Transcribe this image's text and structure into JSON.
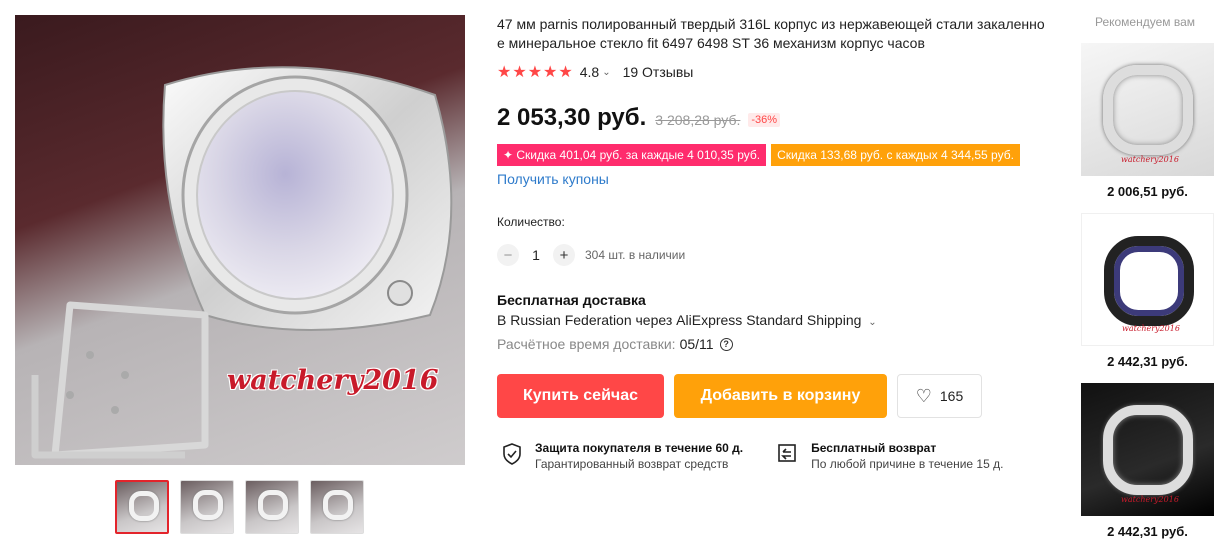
{
  "gallery": {
    "watermark": "watchery2016",
    "thumb_count": 4,
    "active_index": 0
  },
  "product": {
    "title": "47 мм parnis полированный твердый 316L корпус из нержавеющей стали закаленное минеральное стекло fit 6497 6498 ST 36 механизм корпус часов",
    "rating_value": "4.8",
    "reviews": "19 Отзывы",
    "price": "2 053,30 руб.",
    "old_price": "3 208,28 руб.",
    "discount": "-36%",
    "coupons": [
      {
        "text": "✦ Скидка 401,04 руб. за каждые 4 010,35 руб.",
        "color": "#ff2c6d"
      },
      {
        "text": "Скидка 133,68 руб. с каждых 4 344,55 руб.",
        "color": "#ffa10a"
      }
    ],
    "get_coupons": "Получить купоны",
    "quantity_label": "Количество:",
    "quantity_value": "1",
    "stock": "304 шт. в наличии"
  },
  "shipping": {
    "title": "Бесплатная доставка",
    "method": "В Russian Federation через AliExpress Standard Shipping",
    "eta_label": "Расчётное время доставки:",
    "eta_date": "05/11"
  },
  "actions": {
    "buy": "Купить сейчас",
    "cart": "Добавить в корзину",
    "wishlist_count": "165"
  },
  "guarantees": [
    {
      "title": "Защита покупателя в течение 60 д.",
      "sub": "Гарантированный возврат средств"
    },
    {
      "title": "Бесплатный возврат",
      "sub": "По любой причине в течение 15 д."
    }
  ],
  "recommendations": {
    "title": "Рекомендуем вам",
    "items": [
      {
        "price": "2 006,51 руб.",
        "watermark": "watchery2016"
      },
      {
        "price": "2 442,31 руб.",
        "watermark": "watchery2016"
      },
      {
        "price": "2 442,31 руб.",
        "watermark": "watchery2016"
      }
    ]
  },
  "colors": {
    "accent_red": "#ff4747",
    "accent_orange": "#ffa10a",
    "coupon_pink": "#ff2c6d",
    "link_blue": "#2e7bcb"
  }
}
